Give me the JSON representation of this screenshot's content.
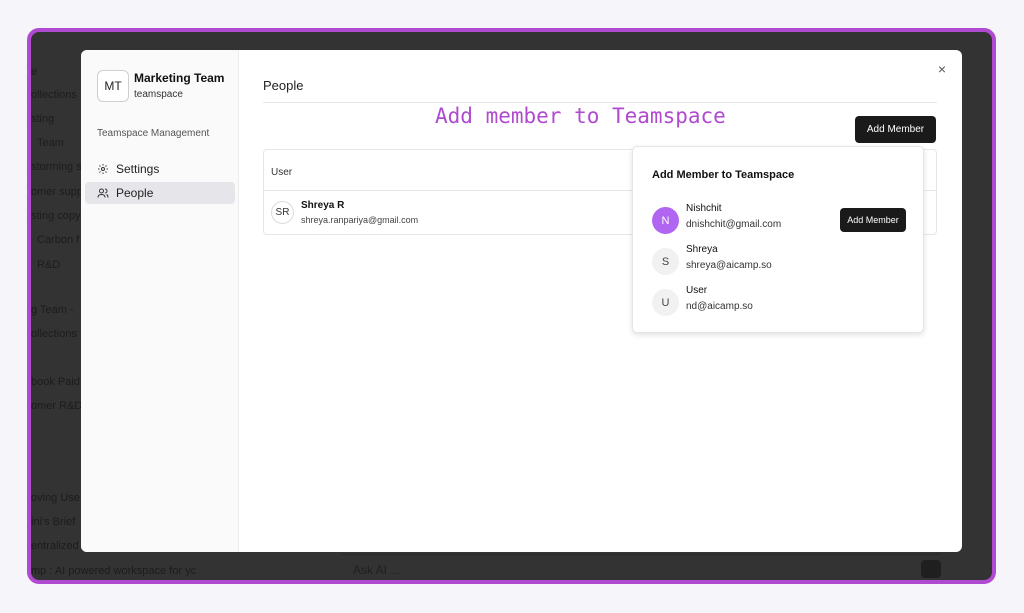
{
  "background_app": {
    "sidebar_items": [
      "e",
      "ollections",
      "sting",
      "Team",
      "storming s",
      "omer supp",
      "sting copy",
      "Carbon f",
      "R&D",
      "g Team -",
      "ollections",
      "book Paid",
      "omer R&D",
      "oving Use",
      "ini's Brief",
      "entralized",
      "mp : AI powered workspace for yc"
    ],
    "ask_placeholder": "Ask AI ..."
  },
  "modal": {
    "team_initials": "MT",
    "team_name": "Marketing Team",
    "team_type": "teamspace",
    "section_label": "Teamspace Management",
    "nav": [
      {
        "label": "Settings",
        "icon": "gear-icon"
      },
      {
        "label": "People",
        "icon": "people-icon",
        "active": true
      }
    ],
    "close_label": "×",
    "page_title": "People",
    "add_member_label": "Add Member",
    "table": {
      "header_user": "User",
      "rows": [
        {
          "initials": "SR",
          "name": "Shreya R",
          "email": "shreya.ranpariya@gmail.com"
        }
      ]
    }
  },
  "caption": "Add member to Teamspace",
  "popover": {
    "title": "Add Member to Teamspace",
    "candidates": [
      {
        "initial": "N",
        "name": "Nishchit",
        "email": "dnishchit@gmail.com",
        "button": "Add Member"
      },
      {
        "initial": "S",
        "name": "Shreya",
        "email": "shreya@aicamp.so"
      },
      {
        "initial": "U",
        "name": "User",
        "email": "nd@aicamp.so"
      }
    ]
  },
  "colors": {
    "accent_purple": "#b04ad0",
    "avatar_purple": "#b066f0",
    "button_dark": "#1a1a1a",
    "overlay": "#333333"
  }
}
